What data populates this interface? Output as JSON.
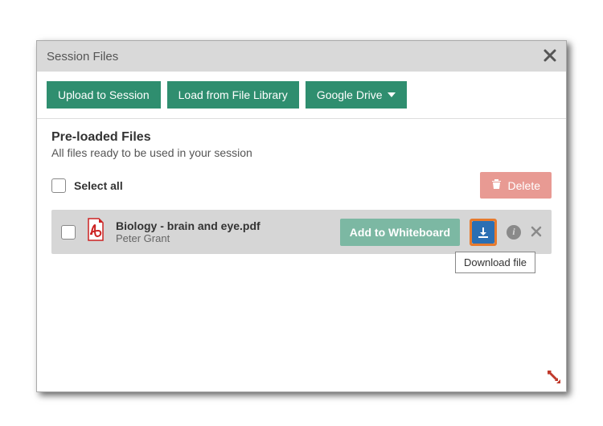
{
  "header": {
    "title": "Session Files"
  },
  "toolbar": {
    "upload": "Upload to Session",
    "load_library": "Load from File Library",
    "google_drive": "Google Drive"
  },
  "section": {
    "title": "Pre-loaded Files",
    "subtitle": "All files ready to be used in your session"
  },
  "selection": {
    "select_all": "Select all",
    "delete": "Delete"
  },
  "files": [
    {
      "name": "Biology - brain and eye.pdf",
      "owner": "Peter Grant",
      "add_label": "Add to Whiteboard"
    }
  ],
  "tooltip": {
    "download": "Download file"
  },
  "colors": {
    "primary_green": "#2f8e6f",
    "delete_red": "#e89a93",
    "download_blue": "#2b6fb3",
    "highlight_orange": "#e77a2d"
  }
}
